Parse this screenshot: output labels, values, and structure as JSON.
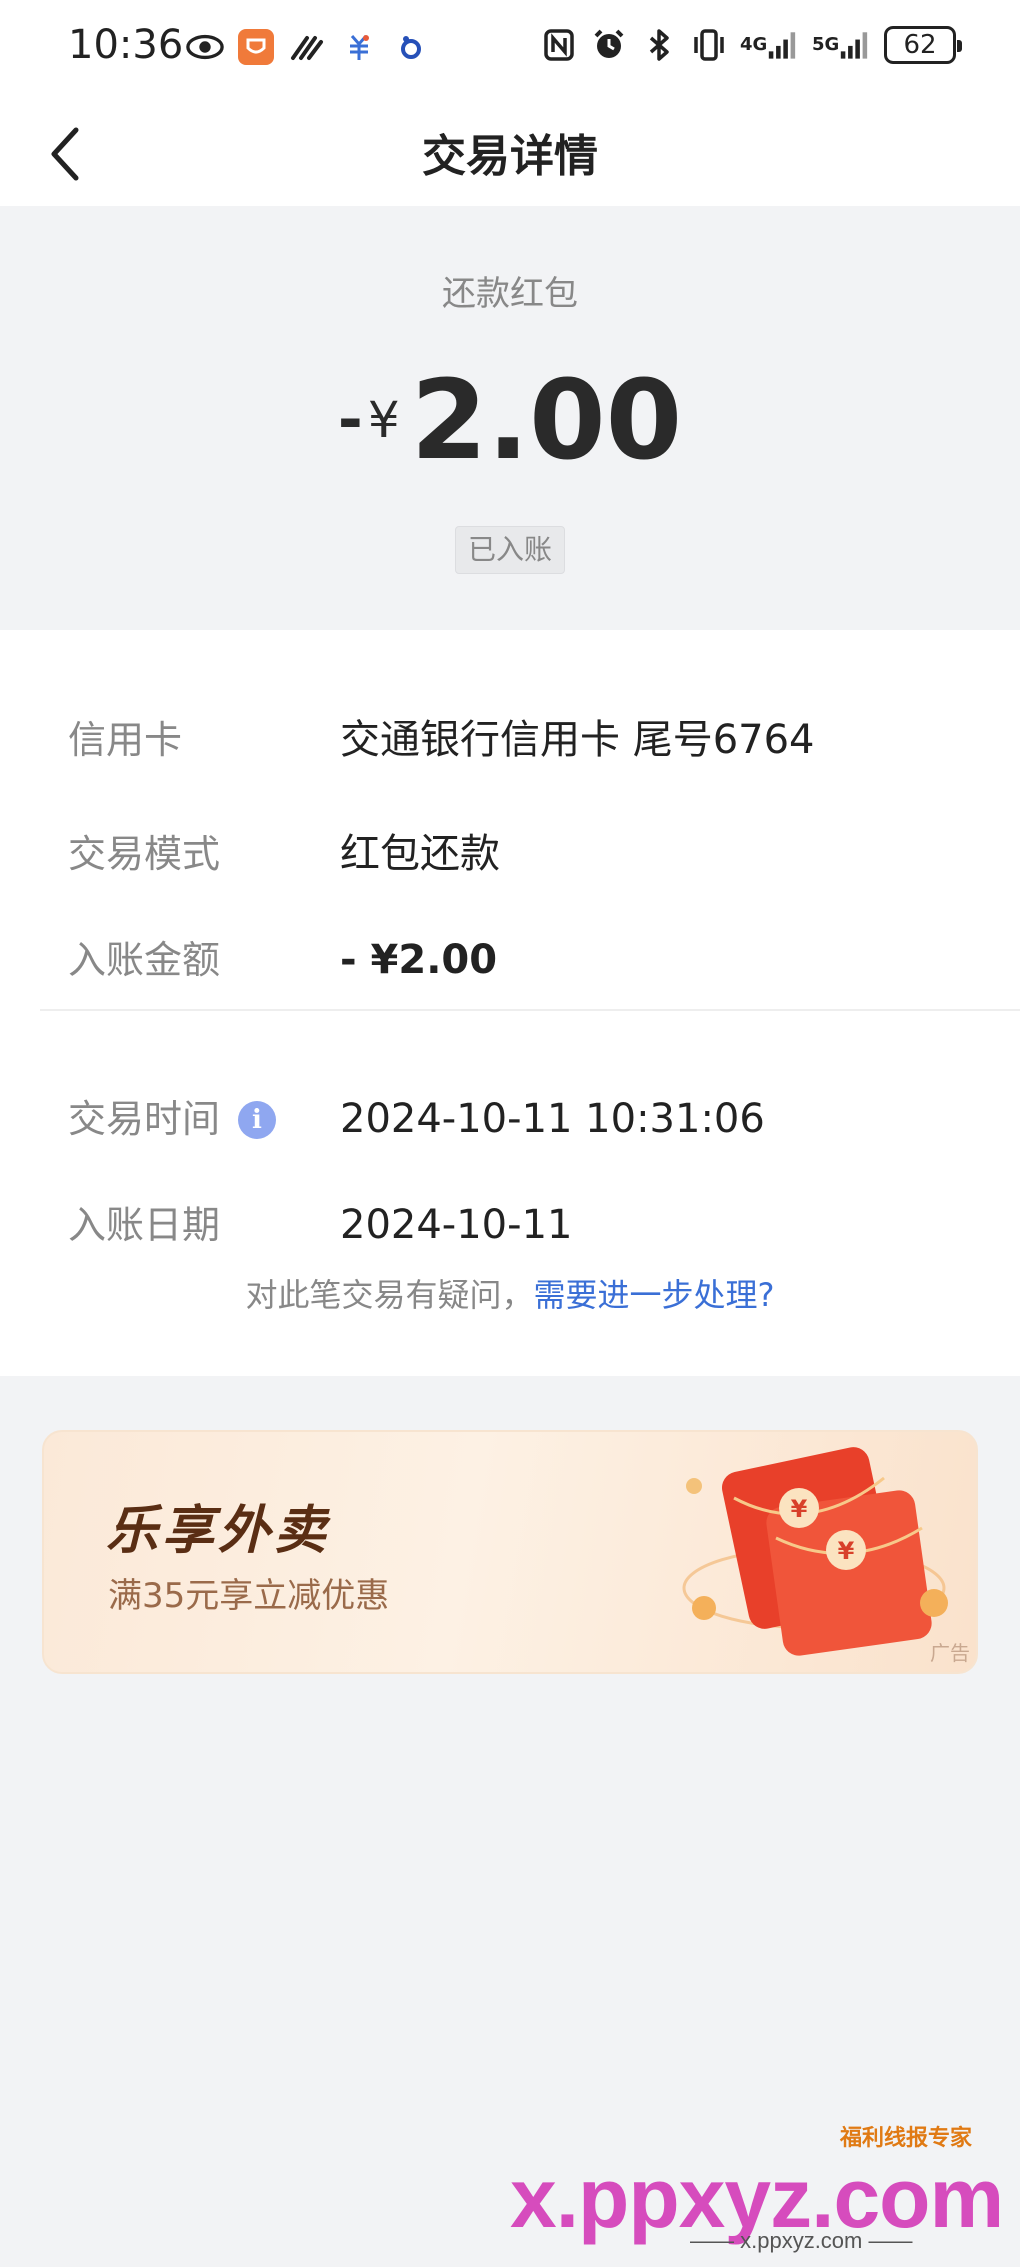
{
  "status_bar": {
    "time": "10:36",
    "battery": "62",
    "net_4g": "4G",
    "net_5g": "5G",
    "left_icons": [
      "eye-icon",
      "app-icon",
      "signal-app-icon",
      "bank-app-icon",
      "baidu-icon"
    ],
    "right_icons": [
      "nfc-icon",
      "alarm-icon",
      "bluetooth-icon",
      "vibrate-icon"
    ]
  },
  "nav": {
    "title": "交易详情"
  },
  "summary": {
    "type_label": "还款红包",
    "sign": "-",
    "currency": "¥",
    "amount": "2.00",
    "status": "已入账"
  },
  "details": {
    "rows": [
      {
        "label": "信用卡",
        "value": "交通银行信用卡 尾号6764"
      },
      {
        "label": "交易模式",
        "value": "红包还款"
      },
      {
        "label": "入账金额",
        "value": "- ¥2.00"
      },
      {
        "label": "交易时间",
        "value": "2024-10-11 10:31:06"
      },
      {
        "label": "入账日期",
        "value": "2024-10-11"
      }
    ],
    "query_text": "对此笔交易有疑问，",
    "query_link": "需要进一步处理?"
  },
  "ad": {
    "title": "乐享外卖",
    "subtitle": "满35元享立减优惠",
    "tag": "广告"
  },
  "watermark": {
    "main": "x.ppxyz.com",
    "top": "福利线报专家",
    "bottom": "—— x.ppxyz.com ——"
  },
  "colors": {
    "accent_link": "#3a6fd6",
    "info_icon": "#8fa7f0",
    "page_bg": "#f2f3f5"
  }
}
